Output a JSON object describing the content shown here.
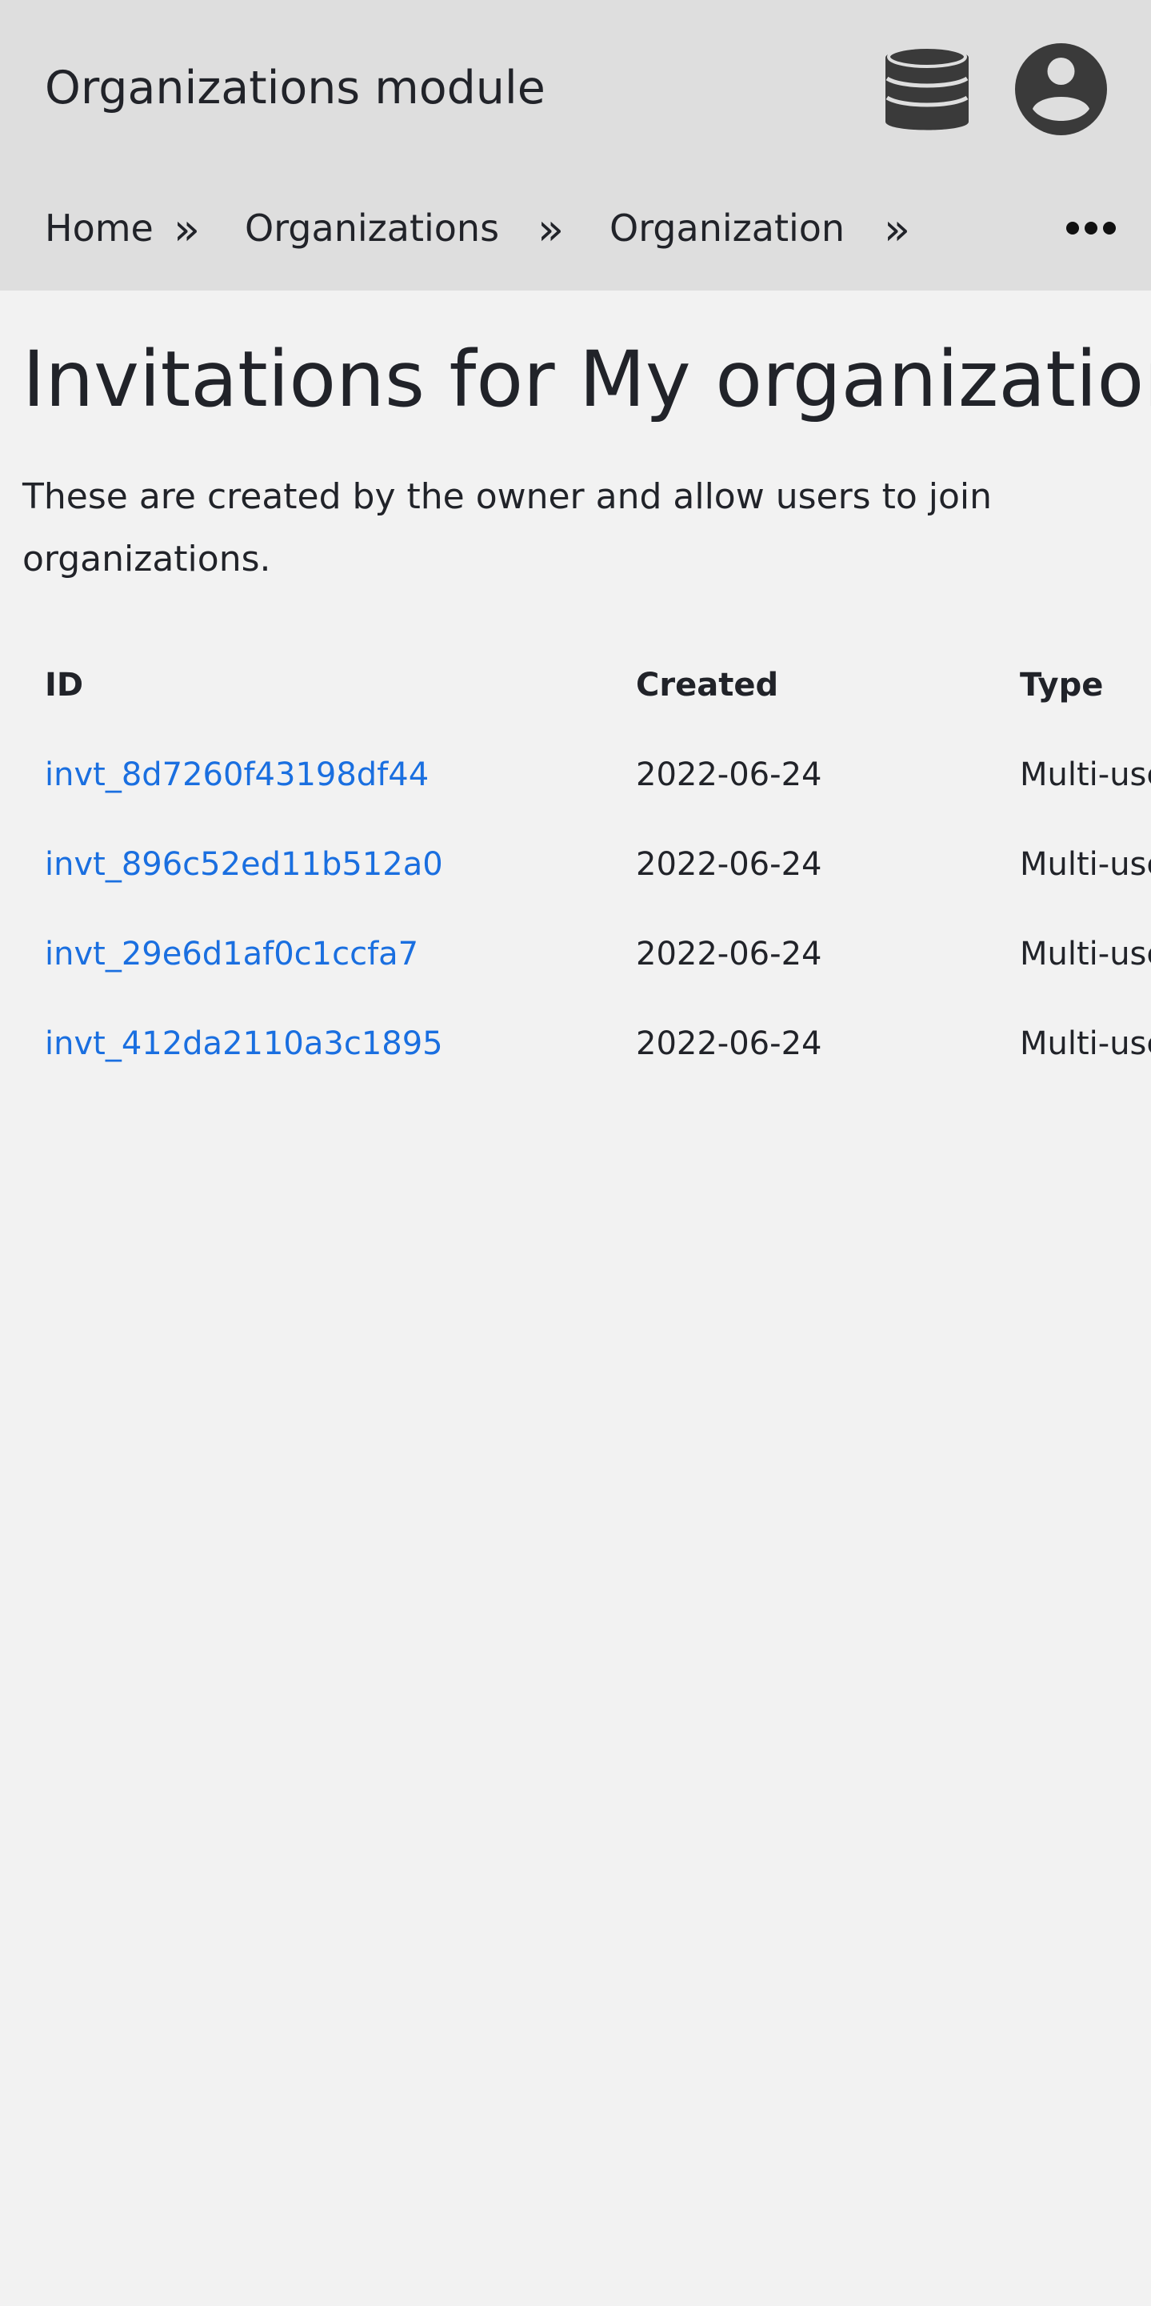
{
  "header": {
    "title": "Organizations module",
    "icons": [
      "database-icon",
      "account-icon"
    ]
  },
  "breadcrumb": {
    "items": [
      "Home",
      "Organizations",
      "Organization"
    ],
    "separator": "»",
    "more_icon": "more-horizontal-icon"
  },
  "page": {
    "title": "Invitations for My organization",
    "description": "These are created by the owner and allow users to join organizations."
  },
  "table": {
    "headers": [
      "ID",
      "Created",
      "Type"
    ],
    "rows": [
      {
        "id": "invt_8d7260f43198df44",
        "created": "2022-06-24",
        "type": "Multi-use"
      },
      {
        "id": "invt_896c52ed11b512a0",
        "created": "2022-06-24",
        "type": "Multi-use"
      },
      {
        "id": "invt_29e6d1af0c1ccfa7",
        "created": "2022-06-24",
        "type": "Multi-use"
      },
      {
        "id": "invt_412da2110a3c1895",
        "created": "2022-06-24",
        "type": "Multi-use"
      }
    ]
  },
  "colors": {
    "header_bg": "#dedede",
    "page_bg": "#f2f2f2",
    "text": "#212329",
    "link": "#1a6fe0",
    "icon": "#3a3a3a"
  }
}
